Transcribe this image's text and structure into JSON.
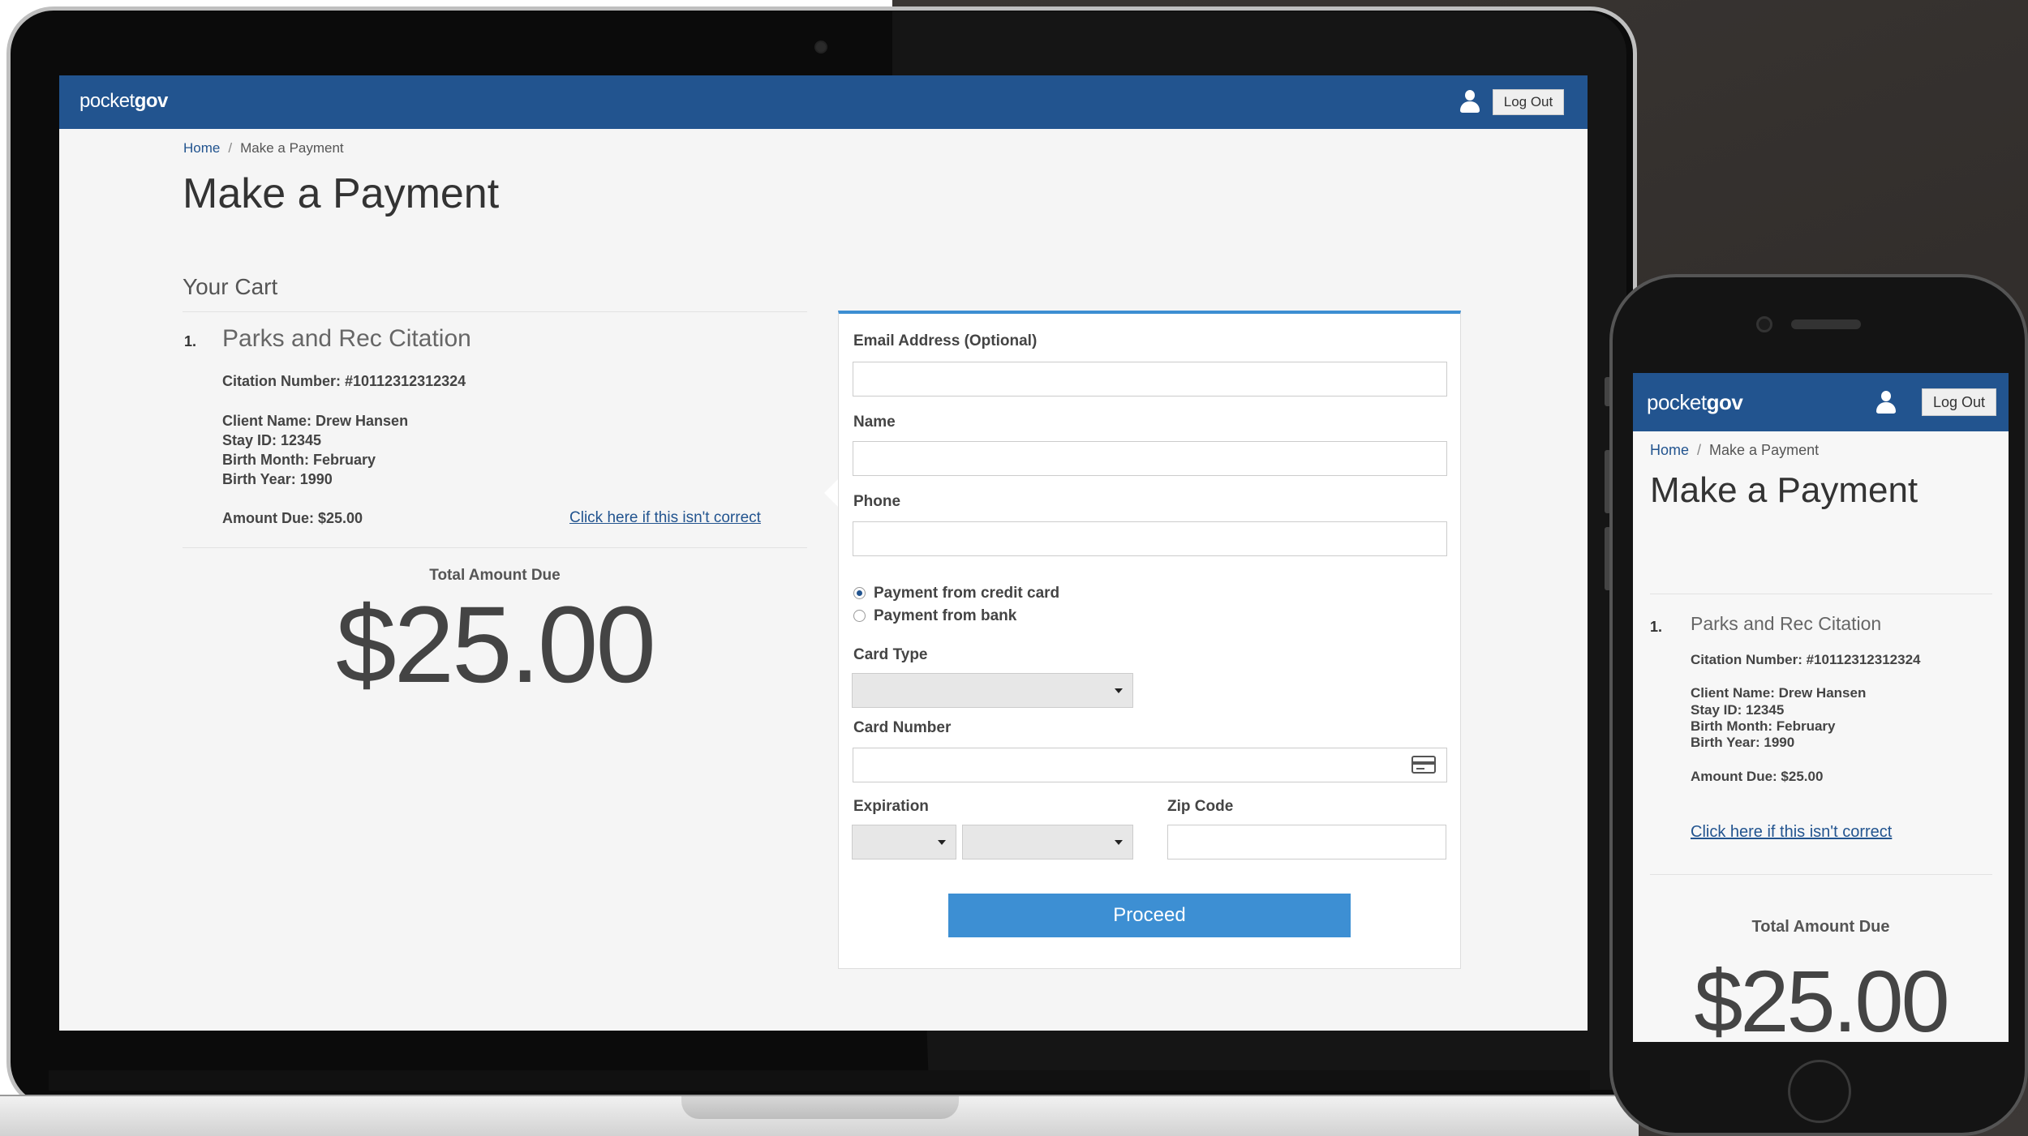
{
  "laptop": {
    "app": {
      "logo_light": "pocket",
      "logo_bold": "gov",
      "logout_label": "Log Out"
    },
    "breadcrumb": {
      "home": "Home",
      "separator": "/",
      "current": "Make a Payment"
    },
    "page_title": "Make a Payment",
    "cart": {
      "heading": "Your Cart",
      "item": {
        "number": "1.",
        "title": "Parks and Rec Citation",
        "citation": "Citation Number:  #10112312312324",
        "client_name": "Client Name: Drew Hansen",
        "stay_id": "Stay ID: 12345",
        "birth_month": "Birth Month: February",
        "birth_year": "Birth Year: 1990",
        "amount_due": "Amount Due: $25.00",
        "correct_link": "Click here if this isn't correct"
      },
      "total_label": "Total Amount Due",
      "total_amount": "$25.00"
    },
    "form": {
      "email_label": "Email Address (Optional)",
      "email_value": "",
      "name_label": "Name",
      "name_value": "",
      "phone_label": "Phone",
      "phone_value": "",
      "payment_options": [
        {
          "label": "Payment from credit card",
          "selected": true
        },
        {
          "label": "Payment from bank",
          "selected": false
        }
      ],
      "card_type_label": "Card Type",
      "card_type_value": "",
      "card_number_label": "Card Number",
      "card_number_value": "",
      "expiration_label": "Expiration",
      "zip_label": "Zip Code",
      "zip_value": "",
      "proceed_label": "Proceed"
    }
  },
  "phone": {
    "app": {
      "logo_light": "pocket",
      "logo_bold": "gov",
      "logout_label": "Log Out"
    },
    "breadcrumb": {
      "home": "Home",
      "separator": "/",
      "current": "Make a Payment"
    },
    "page_title": "Make a Payment",
    "item": {
      "number": "1.",
      "title": "Parks and Rec Citation",
      "citation": "Citation Number:  #10112312312324",
      "client_name": "Client Name: Drew Hansen",
      "stay_id": "Stay ID: 12345",
      "birth_month": "Birth Month: February",
      "birth_year": "Birth Year: 1990",
      "amount_due": "Amount Due: $25.00",
      "correct_link": "Click here if this isn't correct"
    },
    "total_label": "Total Amount Due",
    "total_amount": "$25.00"
  },
  "colors": {
    "navbar": "#22548f",
    "accent": "#3d8fd3",
    "link": "#22548f"
  },
  "icons": [
    "user-icon",
    "credit-card-icon",
    "chevron-down-icon",
    "radio-icon"
  ]
}
